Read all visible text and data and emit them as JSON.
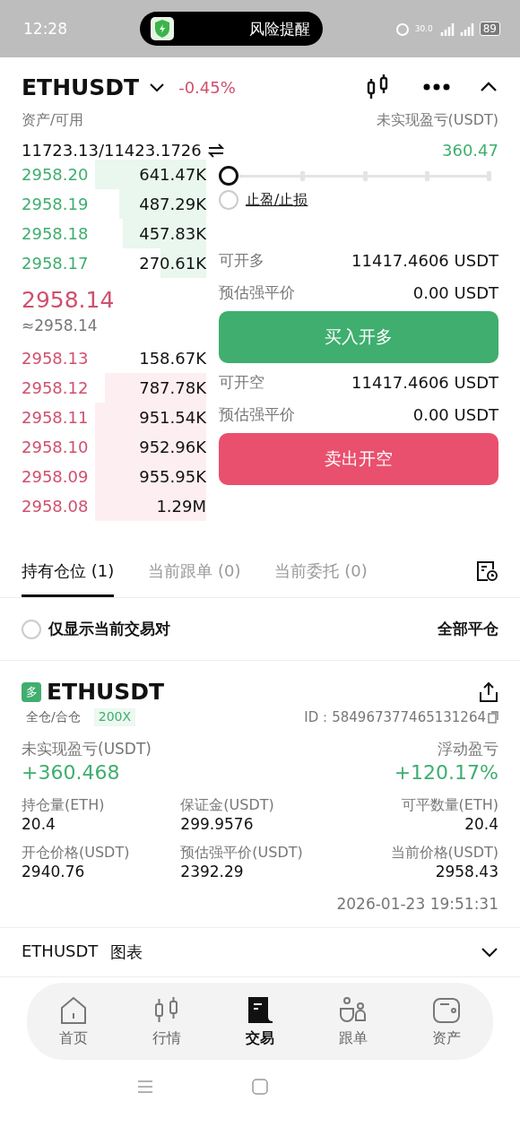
{
  "status_bar": {
    "time": "12:28",
    "notification": "风险提醒",
    "network_speed": "30.0",
    "battery": "89"
  },
  "header": {
    "symbol": "ETHUSDT",
    "change": "-0.45%"
  },
  "account": {
    "assets_label": "资产/可用",
    "assets_value": "11723.13/11423.1726",
    "pnl_label": "未实现盈亏(USDT)",
    "pnl_value": "360.47"
  },
  "bids": [
    {
      "price": "2958.20",
      "amount": "641.47K",
      "level": 0.6
    },
    {
      "price": "2958.19",
      "amount": "487.29K",
      "level": 0.47
    },
    {
      "price": "2958.18",
      "amount": "457.83K",
      "level": 0.45
    },
    {
      "price": "2958.17",
      "amount": "270.61K",
      "level": 0.25
    }
  ],
  "last_price": "2958.14",
  "mark_price": "≈2958.14",
  "asks": [
    {
      "price": "2958.13",
      "amount": "158.67K"
    },
    {
      "price": "2958.12",
      "amount": "787.78K",
      "level": 0.55
    },
    {
      "price": "2958.11",
      "amount": "951.54K",
      "level": 0.6
    },
    {
      "price": "2958.10",
      "amount": "952.96K",
      "level": 0.6
    },
    {
      "price": "2958.09",
      "amount": "955.95K",
      "level": 0.6
    },
    {
      "price": "2958.08",
      "amount": "1.29M",
      "level": 0.6
    }
  ],
  "leverage_slider": {
    "level": 0
  },
  "tp_sl": {
    "label": "止盈/止损",
    "checked": false
  },
  "long": {
    "rows": [
      {
        "label": "可开多",
        "value": "11417.4606 USDT"
      },
      {
        "label": "预估强平价",
        "value": "0.00 USDT"
      }
    ],
    "button": "买入开多"
  },
  "short": {
    "rows": [
      {
        "label": "可开空",
        "value": "11417.4606 USDT"
      },
      {
        "label": "预估强平价",
        "value": "0.00 USDT"
      }
    ],
    "button": "卖出开空"
  },
  "tabs": [
    {
      "label": "持有仓位 (1)",
      "selected": true
    },
    {
      "label": "当前跟单 (0)",
      "selected": false
    },
    {
      "label": "当前委托 (0)",
      "selected": false
    }
  ],
  "filter": {
    "label": "仅显示当前交易对",
    "checked": false,
    "close_all": "全部平仓"
  },
  "position": {
    "side": "多",
    "symbol": "ETHUSDT",
    "margin_mode": "全仓/合仓",
    "leverage": "200X",
    "id": "ID：584967377465131264",
    "pnl_label": "未实现盈亏(USDT)",
    "pnl_value": "+360.468",
    "roe_label": "浮动盈亏",
    "roe_value": "+120.17%",
    "fields": [
      {
        "label": "持仓量(ETH)",
        "value": "20.4"
      },
      {
        "label": "保证金(USDT)",
        "value": "299.9576"
      },
      {
        "label": "可平数量(ETH)",
        "value": "20.4"
      },
      {
        "label": "开仓价格(USDT)",
        "value": "2940.76"
      },
      {
        "label": "预估强平价(USDT)",
        "value": "2392.29"
      },
      {
        "label": "当前价格(USDT)",
        "value": "2958.43"
      }
    ],
    "time": "2026-01-23 19:51:31"
  },
  "chart_row": {
    "symbol": "ETHUSDT",
    "label": "图表"
  },
  "nav": [
    {
      "label": "首页",
      "kind": "home",
      "selected": false
    },
    {
      "label": "行情",
      "kind": "market",
      "selected": false
    },
    {
      "label": "交易",
      "kind": "trade",
      "selected": true
    },
    {
      "label": "跟单",
      "kind": "copy",
      "selected": false
    },
    {
      "label": "资产",
      "kind": "wallet",
      "selected": false
    }
  ]
}
